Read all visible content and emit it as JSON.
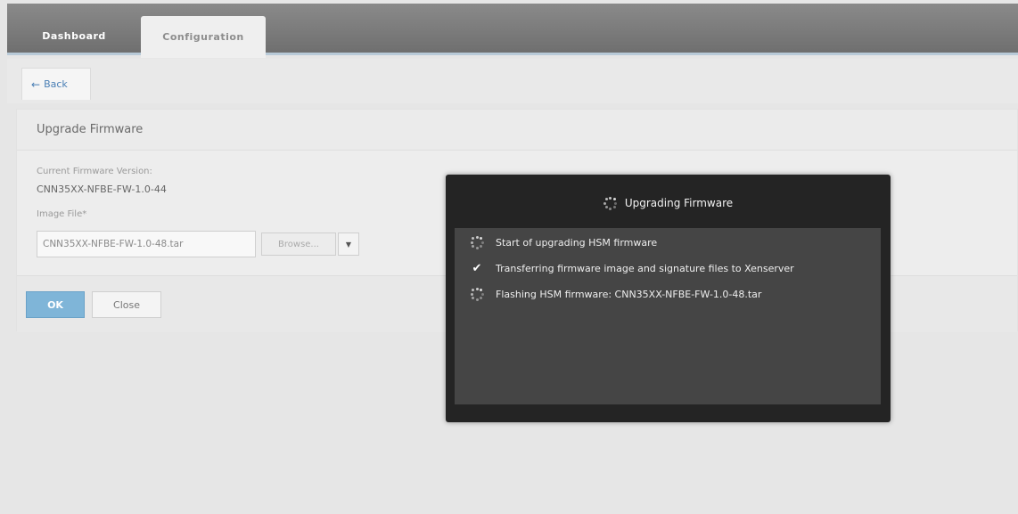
{
  "nav": {
    "tabs": [
      {
        "label": "Dashboard",
        "active": false
      },
      {
        "label": "Configuration",
        "active": true
      }
    ]
  },
  "back": {
    "label": "Back",
    "icon": "arrow-left-icon"
  },
  "form": {
    "title": "Upgrade Firmware",
    "current_version_label": "Current Firmware Version:",
    "current_version_value": "CNN35XX-NFBE-FW-1.0-44",
    "image_file_label": "Image File*",
    "image_file_value": "CNN35XX-NFBE-FW-1.0-48.tar",
    "browse_label": "Browse...",
    "ok_label": "OK",
    "close_label": "Close"
  },
  "modal": {
    "title": "Upgrading Firmware",
    "steps": [
      {
        "label": "Start of upgrading HSM firmware",
        "status": "in-progress",
        "icon": "spinner-icon"
      },
      {
        "label": "Transferring firmware image and signature files to Xenserver",
        "status": "done",
        "icon": "check-icon"
      },
      {
        "label": "Flashing HSM firmware: CNN35XX-NFBE-FW-1.0-48.tar",
        "status": "in-progress",
        "icon": "spinner-icon"
      }
    ]
  },
  "colors": {
    "modal_bg": "#242424",
    "modal_body_bg": "#454545",
    "ok_button": "#7fb5d8",
    "link": "#4a7fb5"
  }
}
